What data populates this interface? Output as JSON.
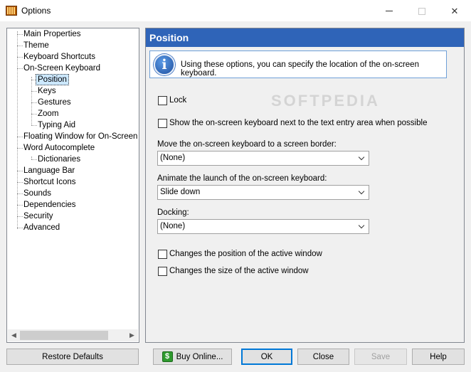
{
  "window": {
    "title": "Options"
  },
  "tree": {
    "items": [
      {
        "label": "Main Properties",
        "level": 0
      },
      {
        "label": "Theme",
        "level": 0
      },
      {
        "label": "Keyboard Shortcuts",
        "level": 0
      },
      {
        "label": "On-Screen Keyboard",
        "level": 0
      },
      {
        "label": "Position",
        "level": 1,
        "selected": true
      },
      {
        "label": "Keys",
        "level": 1
      },
      {
        "label": "Gestures",
        "level": 1
      },
      {
        "label": "Zoom",
        "level": 1
      },
      {
        "label": "Typing Aid",
        "level": 1
      },
      {
        "label": "Floating Window for On-Screen Ke",
        "level": 0
      },
      {
        "label": "Word Autocomplete",
        "level": 0
      },
      {
        "label": "Dictionaries",
        "level": 1
      },
      {
        "label": "Language Bar",
        "level": 0
      },
      {
        "label": "Shortcut Icons",
        "level": 0
      },
      {
        "label": "Sounds",
        "level": 0
      },
      {
        "label": "Dependencies",
        "level": 0
      },
      {
        "label": "Security",
        "level": 0
      },
      {
        "label": "Advanced",
        "level": 0
      }
    ]
  },
  "panel": {
    "header": "Position",
    "info_text": "Using these options, you can specify the location of the on-screen keyboard.",
    "watermark": "SOFTPEDIA",
    "lock_label": "Lock",
    "lock_checked": false,
    "show_next_label": "Show the on-screen keyboard next to the text entry area when possible",
    "show_next_checked": false,
    "border_label": "Move the on-screen keyboard to a screen border:",
    "border_value": "(None)",
    "animate_label": "Animate the launch of the on-screen keyboard:",
    "animate_value": "Slide down",
    "docking_label": "Docking:",
    "docking_value": "(None)",
    "change_pos_label": "Changes the position of the active window",
    "change_pos_checked": false,
    "change_size_label": "Changes the size of the active window",
    "change_size_checked": false
  },
  "buttons": {
    "restore": "Restore Defaults",
    "buy": "Buy Online...",
    "ok": "OK",
    "close": "Close",
    "save": "Save",
    "help": "Help"
  },
  "colors": {
    "header_bg": "#2f64b8",
    "selection_bg": "#cce8ff",
    "default_button_border": "#0078d7"
  }
}
